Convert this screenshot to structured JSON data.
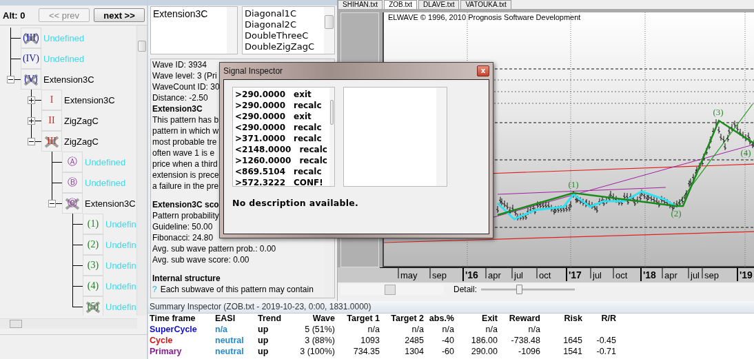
{
  "wave_tree": {
    "alt_label": "Alt: 0",
    "prev_button": "<< prev",
    "next_button": "next >>",
    "items": [
      {
        "badge": "(III)",
        "label": "Undefined",
        "color": "#40d8e8",
        "crossed": true
      },
      {
        "badge": "(IV)",
        "label": "Undefined",
        "color": "#40d8e8",
        "crossed": false
      },
      {
        "badge": "(V)",
        "label": "Extension3C",
        "color": "#000000",
        "crossed": true,
        "expanded": true,
        "children": [
          {
            "badge": "I",
            "label": "Extension3C",
            "color": "#000000",
            "crossed": false,
            "expanded": false
          },
          {
            "badge": "II",
            "label": "ZigZagC",
            "color": "#000000",
            "crossed": false,
            "expanded": false
          },
          {
            "badge": "III",
            "label": "ZigZagC",
            "color": "#000000",
            "crossed": true,
            "expanded": true,
            "children": [
              {
                "badge": "Ⓐ",
                "label": "Undefined",
                "color": "#40d8e8",
                "crossed": false
              },
              {
                "badge": "Ⓑ",
                "label": "Undefined",
                "color": "#40d8e8",
                "crossed": false
              },
              {
                "badge": "Ⓒ",
                "label": "Extension3C",
                "color": "#000000",
                "crossed": true,
                "expanded": true,
                "children": [
                  {
                    "badge": "(1)",
                    "label": "Undefin",
                    "color": "#40d8e8",
                    "crossed": false
                  },
                  {
                    "badge": "(2)",
                    "label": "Undefin",
                    "color": "#40d8e8",
                    "crossed": false
                  },
                  {
                    "badge": "(3)",
                    "label": "Undefin",
                    "color": "#40d8e8",
                    "crossed": false
                  },
                  {
                    "badge": "(4)",
                    "label": "Undefin",
                    "color": "#40d8e8",
                    "crossed": false
                  },
                  {
                    "badge": "(5)",
                    "label": "Undefin",
                    "color": "#40d8e8",
                    "crossed": true
                  }
                ]
              }
            ]
          }
        ]
      }
    ]
  },
  "wave_inspector": {
    "pattern_list": [
      "Extension3C"
    ],
    "pattern_choices": [
      "Diagonal1C",
      "Diagonal2C",
      "DoubleThreeC",
      "DoubleZigZagC"
    ],
    "sections": [
      [
        {
          "kind": "text",
          "text": "Wave ID: 3934"
        },
        {
          "kind": "text",
          "text": "Wave level: 3 (Pri"
        },
        {
          "kind": "text",
          "text": "WaveCount ID: 30"
        },
        {
          "kind": "text",
          "text": "Distance: -2.50"
        },
        {
          "kind": "heading",
          "text": "Extension3C"
        },
        {
          "kind": "text",
          "text": "This pattern has b"
        },
        {
          "kind": "text",
          "text": "pattern in which w"
        },
        {
          "kind": "text",
          "text": "most probable tre"
        },
        {
          "kind": "text",
          "text": "often wave 1 is e"
        },
        {
          "kind": "text",
          "text": "price when a third"
        },
        {
          "kind": "text",
          "text": "extension is prece"
        },
        {
          "kind": "text",
          "text": "a failure in the pre"
        }
      ],
      [
        {
          "kind": "heading",
          "text": "Extension3C sco"
        },
        {
          "kind": "text",
          "text": "Pattern probability"
        },
        {
          "kind": "text",
          "text": "Guideline: 50.00"
        },
        {
          "kind": "text",
          "text": "Fibonacci: 24.80"
        },
        {
          "kind": "text",
          "text": "Avg. sub wave pattern prob.: 0.00"
        },
        {
          "kind": "text",
          "text": "Avg. sub wave score: 0.00"
        }
      ],
      [
        {
          "kind": "heading",
          "text": "Internal structure"
        },
        {
          "kind": "hint",
          "icon": "?",
          "text": "Each subwave of this pattern may contain"
        }
      ]
    ]
  },
  "tabs": [
    {
      "label": "SHIHAN.txt",
      "selected": false
    },
    {
      "label": "ZOB.txt",
      "selected": true
    },
    {
      "label": "DLAVE.txt",
      "selected": false
    },
    {
      "label": "VATOUKA.txt",
      "selected": false
    }
  ],
  "chart": {
    "copyright": "ELWAVE © 1996, 2010 Prognosis Software Development",
    "wave_labels": [
      "(1)",
      "(2)",
      "(3)",
      "(4)"
    ],
    "axis_labels": [
      {
        "text": "may",
        "kind": "month"
      },
      {
        "text": "sep",
        "kind": "month"
      },
      {
        "text": "'16",
        "kind": "year"
      },
      {
        "text": "apr",
        "kind": "month"
      },
      {
        "text": "jul",
        "kind": "month"
      },
      {
        "text": "oct",
        "kind": "month"
      },
      {
        "text": "'17",
        "kind": "year"
      },
      {
        "text": "jul",
        "kind": "month"
      },
      {
        "text": "oct",
        "kind": "month"
      },
      {
        "text": "'18",
        "kind": "year"
      },
      {
        "text": "apr",
        "kind": "month"
      },
      {
        "text": "jul",
        "kind": "month"
      },
      {
        "text": "sep",
        "kind": "month"
      },
      {
        "text": "'19",
        "kind": "year"
      }
    ],
    "detail_label": "Detail:",
    "detail": {
      "level": 0.4
    }
  },
  "signal_inspector": {
    "title": "Signal Inspector",
    "close": "x",
    "signals": [
      {
        "price": ">290.0000",
        "signal": "exit"
      },
      {
        "price": ">290.0000",
        "signal": "recalc"
      },
      {
        "price": "<290.0000",
        "signal": "exit"
      },
      {
        "price": "<290.0000",
        "signal": "recalc"
      },
      {
        "price": ">371.0000",
        "signal": "recalc"
      },
      {
        "price": "<2148.0000",
        "signal": "recalc"
      },
      {
        "price": ">1260.0000",
        "signal": "recalc"
      },
      {
        "price": "<869.5104",
        "signal": "recalc"
      },
      {
        "price": ">572.3222",
        "signal": "CONF!"
      }
    ],
    "description": "No description available."
  },
  "summary_inspector": {
    "title": "Summary Inspector (ZOB.txt - 2019-10-23, 0:00, 1831.0000)",
    "columns": [
      "Time frame",
      "EASI",
      "Trend",
      "Wave",
      "Target 1",
      "Target 2",
      "abs.%",
      "Exit",
      "Reward",
      "Risk",
      "R/R"
    ],
    "rows": [
      {
        "color": "#1010d0",
        "cells": [
          "SuperCycle",
          "n/a",
          "up",
          "5 (51%)",
          "n/a",
          "n/a",
          "n/a",
          "n/a",
          "n/a",
          "",
          ""
        ]
      },
      {
        "color": "#d01818",
        "cells": [
          "Cycle",
          "neutral",
          "up",
          "3 (88%)",
          "1093",
          "2485",
          "-40",
          "186.00",
          "-738.48",
          "1645",
          "-0.45"
        ]
      },
      {
        "color": "#8a1a9a",
        "cells": [
          "Primary",
          "neutral",
          "up",
          "3 (100%)",
          "734.35",
          "1304",
          "-60",
          "290.00",
          "-1096",
          "1541",
          "-0.71"
        ]
      }
    ]
  }
}
